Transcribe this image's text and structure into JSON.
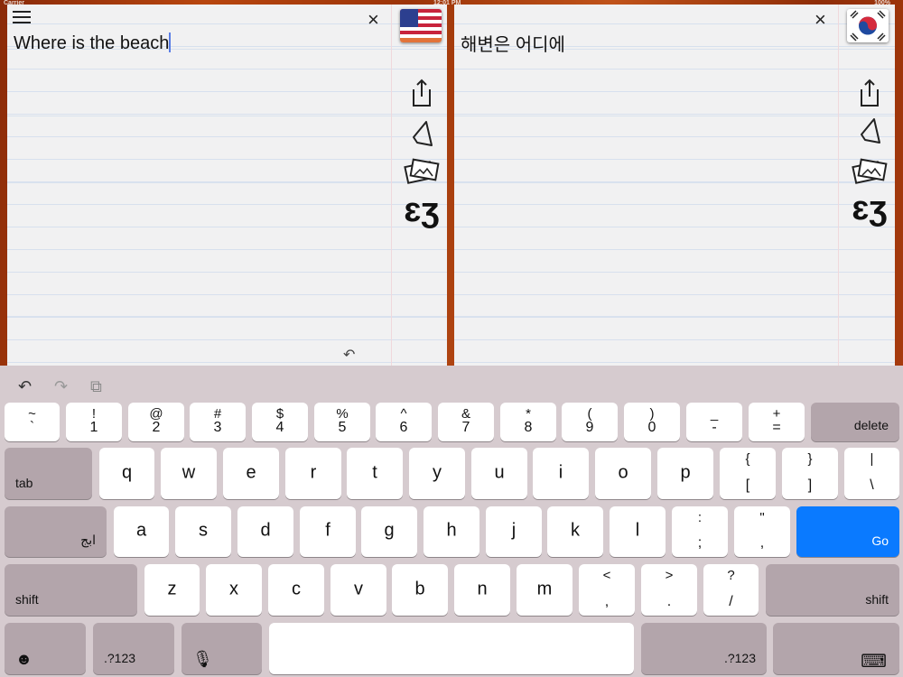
{
  "status": {
    "carrier": "Carrier",
    "time": "12:01 PM",
    "battery": "100%"
  },
  "source": {
    "text": "Where is the beach",
    "flag": "us-flag"
  },
  "target": {
    "text": "해변은 어디에",
    "flag": "korea-flag"
  },
  "icons": {
    "close": "×",
    "menu": "menu-icon",
    "undo_text": "↶"
  },
  "keyboard": {
    "toolbar": [
      "↶",
      "↷",
      "⧉"
    ],
    "rows": [
      [
        {
          "up": "~",
          "dn": "`"
        },
        {
          "up": "!",
          "dn": "1"
        },
        {
          "up": "@",
          "dn": "2"
        },
        {
          "up": "#",
          "dn": "3"
        },
        {
          "up": "$",
          "dn": "4"
        },
        {
          "up": "%",
          "dn": "5"
        },
        {
          "up": "^",
          "dn": "6"
        },
        {
          "up": "&",
          "dn": "7"
        },
        {
          "up": "*",
          "dn": "8"
        },
        {
          "up": "(",
          "dn": "9"
        },
        {
          "up": ")",
          "dn": "0"
        },
        {
          "up": "_",
          "dn": "-"
        },
        {
          "up": "+",
          "dn": "="
        },
        {
          "lbl": "delete",
          "type": "sp"
        }
      ],
      [
        {
          "lbl": "tab",
          "type": "sp"
        },
        {
          "main": "q"
        },
        {
          "main": "w"
        },
        {
          "main": "e"
        },
        {
          "main": "r"
        },
        {
          "main": "t"
        },
        {
          "main": "y"
        },
        {
          "main": "u"
        },
        {
          "main": "i"
        },
        {
          "main": "o"
        },
        {
          "main": "p"
        },
        {
          "up": "{",
          "dn": "["
        },
        {
          "up": "}",
          "dn": "]"
        },
        {
          "up": "|",
          "dn": "\\"
        }
      ],
      [
        {
          "lbl": "ابج",
          "type": "sp"
        },
        {
          "main": "a"
        },
        {
          "main": "s"
        },
        {
          "main": "d"
        },
        {
          "main": "f"
        },
        {
          "main": "g"
        },
        {
          "main": "h"
        },
        {
          "main": "j"
        },
        {
          "main": "k"
        },
        {
          "main": "l"
        },
        {
          "up": ":",
          "dn": ";"
        },
        {
          "up": "\"",
          "dn": ","
        },
        {
          "lbl": "Go",
          "type": "go"
        }
      ],
      [
        {
          "lbl": "shift",
          "type": "sp"
        },
        {
          "main": "z"
        },
        {
          "main": "x"
        },
        {
          "main": "c"
        },
        {
          "main": "v"
        },
        {
          "main": "b"
        },
        {
          "main": "n"
        },
        {
          "main": "m"
        },
        {
          "up": "<",
          "dn": ","
        },
        {
          "up": ">",
          "dn": "."
        },
        {
          "up": "?",
          "dn": "/"
        },
        {
          "lbl": "shift",
          "type": "sp"
        }
      ],
      [
        {
          "main": "☻",
          "type": "sp"
        },
        {
          "lbl": ".?123",
          "type": "sp"
        },
        {
          "main": "🎙",
          "type": "sp"
        },
        {
          "main": "",
          "name": "space"
        },
        {
          "lbl": ".?123",
          "type": "sp"
        },
        {
          "main": "⌨",
          "type": "sp"
        }
      ]
    ]
  }
}
